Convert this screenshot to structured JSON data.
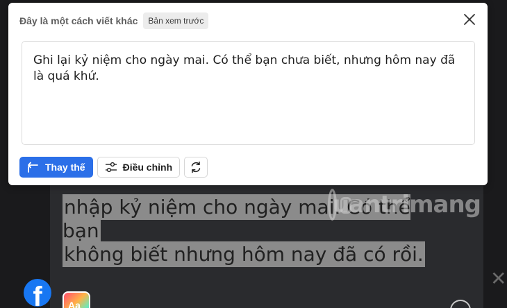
{
  "background": {
    "editor_text_line1": "nhập kỷ niệm cho ngày mai. Có thể bạn",
    "editor_text_line2": "không biết nhưng hôm nay đã có rồi.",
    "watermark": "uantrimang",
    "app_icon_label": "Aa"
  },
  "dialog": {
    "title": "Đây là một cách viết khác",
    "badge": "Bản xem trước",
    "suggestion_text": "Ghi lại kỷ niệm cho ngày mai. Có thể bạn chưa biết, nhưng hôm nay đã là quá khứ.",
    "buttons": {
      "replace": "Thay thế",
      "adjust": "Điều chỉnh"
    }
  },
  "colors": {
    "primary": "#2b6fe8",
    "dialog_bg": "#ffffff",
    "page_bg": "#1a1a1c",
    "highlight": "#8b8b8b"
  }
}
